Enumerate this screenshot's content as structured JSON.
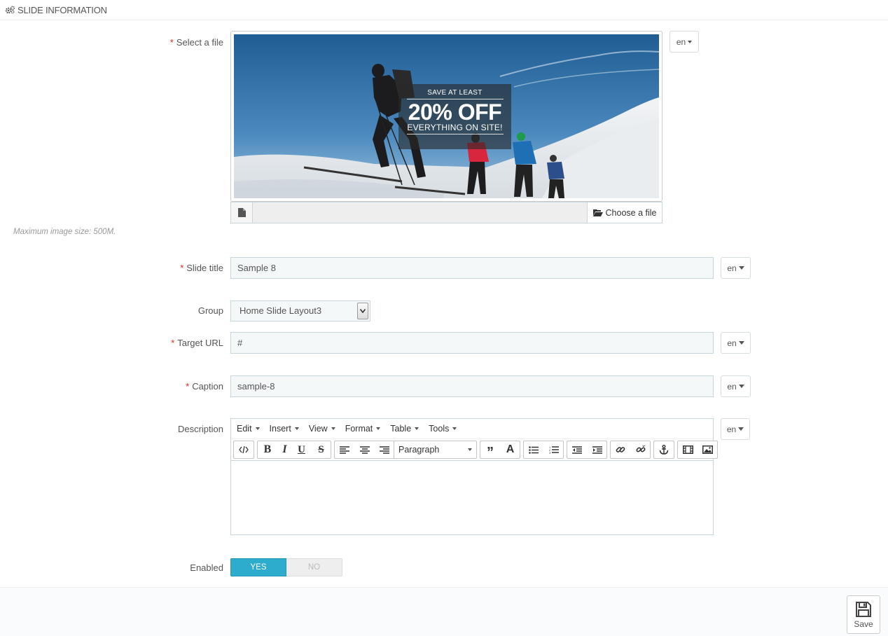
{
  "panel": {
    "title": "SLIDE INFORMATION"
  },
  "fields": {
    "file": {
      "label": "Select a file",
      "banner": {
        "line1": "SAVE AT LEAST",
        "line2": "20% OFF",
        "line3": "EVERYTHING ON SITE!"
      },
      "choose_label": "Choose a file",
      "hint": "Maximum image size: 500M.",
      "lang": "en"
    },
    "title": {
      "label": "Slide title",
      "value": "Sample 8",
      "lang": "en"
    },
    "group": {
      "label": "Group",
      "value": "Home Slide Layout3"
    },
    "url": {
      "label": "Target URL",
      "value": "#",
      "lang": "en"
    },
    "caption": {
      "label": "Caption",
      "value": "sample-8",
      "lang": "en"
    },
    "description": {
      "label": "Description",
      "lang": "en",
      "menu": [
        "Edit",
        "Insert",
        "View",
        "Format",
        "Table",
        "Tools"
      ],
      "format_select": "Paragraph",
      "content": ""
    },
    "enabled": {
      "label": "Enabled",
      "yes": "YES",
      "no": "NO",
      "value": true
    }
  },
  "footer": {
    "save_label": "Save"
  },
  "colors": {
    "accent": "#2eacce",
    "required": "#e0261a"
  },
  "icons": [
    "cogs-icon",
    "file-icon",
    "folder-open-icon",
    "save-icon",
    "source-code-icon",
    "bold-icon",
    "italic-icon",
    "underline-icon",
    "strikethrough-icon",
    "align-left-icon",
    "align-center-icon",
    "align-right-icon",
    "blockquote-icon",
    "text-color-icon",
    "bullet-list-icon",
    "numbered-list-icon",
    "outdent-icon",
    "indent-icon",
    "link-icon",
    "unlink-icon",
    "anchor-icon",
    "media-icon",
    "image-icon"
  ]
}
